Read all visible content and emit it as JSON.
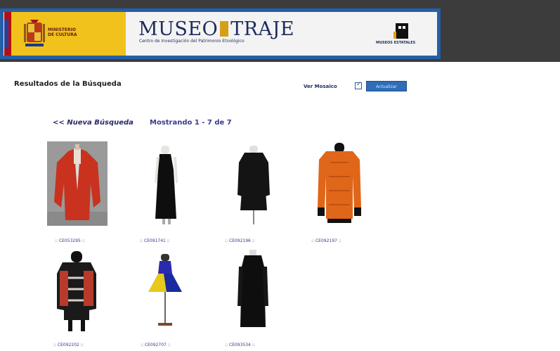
{
  "header": {
    "ministry": "MINISTERIO DE CULTURA",
    "title_left": "MUSEO",
    "title_right": "TRAJE",
    "subtitle": "Centro de Investigación del Patrimonio Etnológico",
    "estatales": "MUSEOS ESTATALES"
  },
  "toolbar": {
    "results_title": "Resultados de la Búsqueda",
    "ver_mosaico_label": "Ver Mosaico",
    "ver_mosaico_checked": true,
    "actualizar_label": "Actualizar"
  },
  "nav": {
    "nueva_busqueda": "<< Nueva Búsqueda",
    "mostrando": "Mostrando 1 - 7 de 7"
  },
  "colors": {
    "accent": "#2360a8",
    "link": "#3a3a8a"
  },
  "items": [
    {
      "caption": ":: CE053295 ::",
      "icon": "red-coat-image"
    },
    {
      "caption": ":: CE091741 ::",
      "icon": "black-sleeveless-dress-image"
    },
    {
      "caption": ":: CE092196 ::",
      "icon": "black-coat-dress-image"
    },
    {
      "caption": ":: CE092197 ::",
      "icon": "orange-jacket-image"
    },
    {
      "caption": ":: CE092202 ::",
      "icon": "patterned-jacket-image"
    },
    {
      "caption": ":: CE092707 ::",
      "icon": "blue-yellow-dress-image"
    },
    {
      "caption": ":: CE093534 ::",
      "icon": "black-long-coat-image"
    }
  ]
}
